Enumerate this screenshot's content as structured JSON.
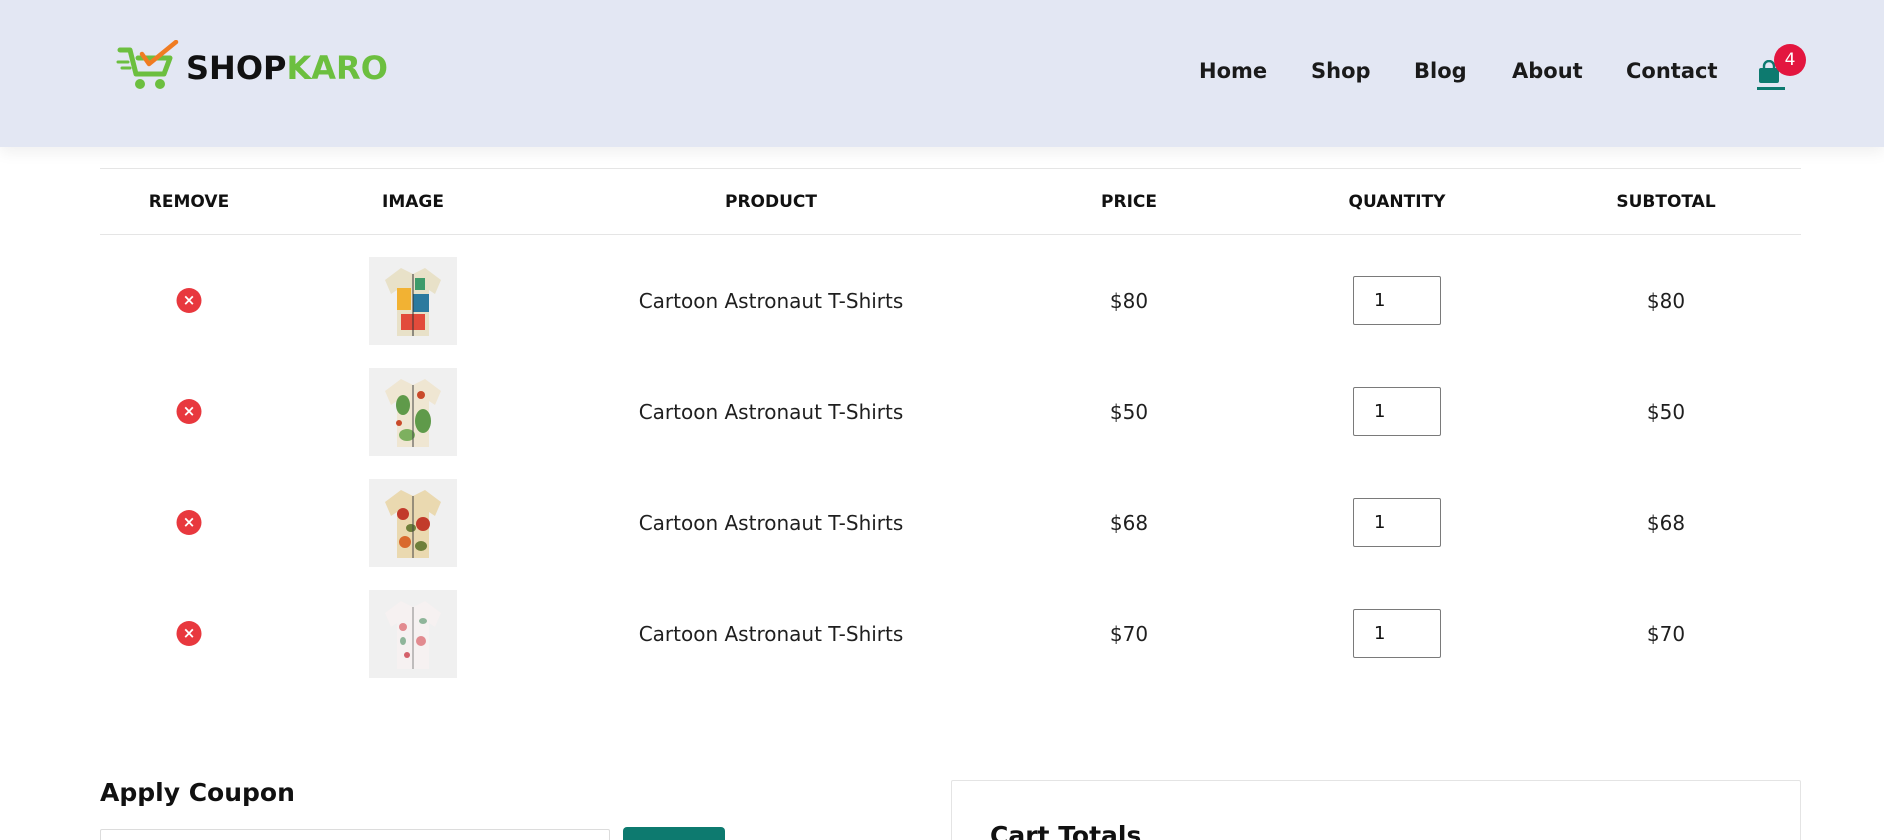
{
  "brand": {
    "part1": "SHOP",
    "part2": "KARO",
    "accent_color": "#6cbf3f",
    "check_color": "#f07c22"
  },
  "nav": {
    "items": [
      "Home",
      "Shop",
      "Blog",
      "About",
      "Contact"
    ]
  },
  "cart": {
    "count": "4",
    "badge_color": "#e3163f",
    "icon": "shopping-bag-icon"
  },
  "table": {
    "headers": [
      "REMOVE",
      "IMAGE",
      "PRODUCT",
      "PRICE",
      "QUANTITY",
      "SUBTOTAL"
    ],
    "rows": [
      {
        "product": "Cartoon Astronaut T-Shirts",
        "price": "$80",
        "quantity": "1",
        "subtotal": "$80",
        "image": "colorful-patchwork-shirt",
        "shirt_colors": [
          "#f2b233",
          "#2c7a9e",
          "#e8e1c8"
        ]
      },
      {
        "product": "Cartoon Astronaut T-Shirts",
        "price": "$50",
        "quantity": "1",
        "subtotal": "$50",
        "image": "green-floral-shirt",
        "shirt_colors": [
          "#efe6d2",
          "#5f9a4a",
          "#c94a2a"
        ]
      },
      {
        "product": "Cartoon Astronaut T-Shirts",
        "price": "$68",
        "quantity": "1",
        "subtotal": "$68",
        "image": "tropical-print-shirt",
        "shirt_colors": [
          "#ead9b0",
          "#c23b2b",
          "#6e7f3a"
        ]
      },
      {
        "product": "Cartoon Astronaut T-Shirts",
        "price": "$70",
        "quantity": "1",
        "subtotal": "$70",
        "image": "white-floral-shirt",
        "shirt_colors": [
          "#f6f1f1",
          "#e28a8f",
          "#8fb59a"
        ]
      }
    ]
  },
  "coupon": {
    "title": "Apply Coupon",
    "placeholder": ""
  },
  "totals": {
    "title": "Cart Totals"
  },
  "colors": {
    "header_bg": "#e3e7f3",
    "primary": "#0d7a6f",
    "remove": "#e8383e"
  }
}
